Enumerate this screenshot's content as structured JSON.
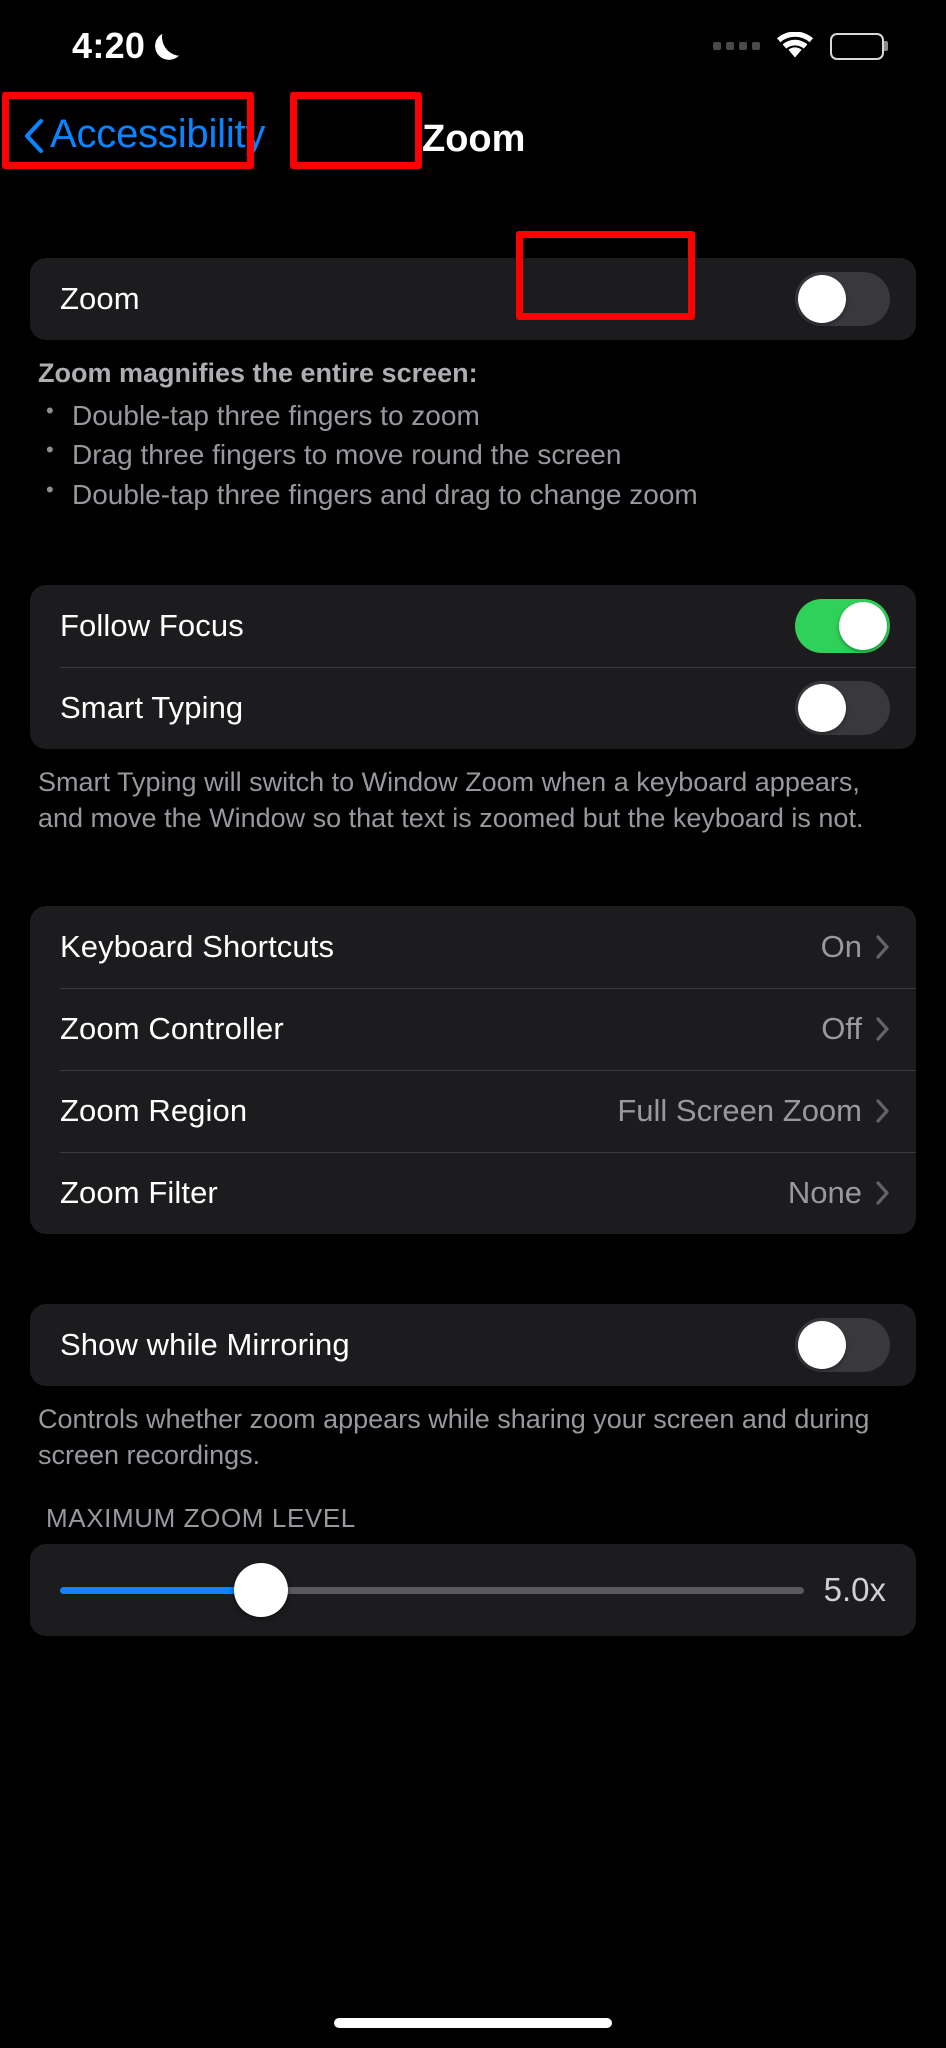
{
  "status_bar": {
    "time": "4:20",
    "dnd_icon": "moon-icon",
    "signal_icon": "signal-dots-icon",
    "wifi_icon": "wifi-icon",
    "battery_icon": "battery-icon"
  },
  "nav": {
    "back_label": "Accessibility",
    "back_icon": "chevron-left-icon",
    "title": "Zoom"
  },
  "zoom_section": {
    "row_label": "Zoom",
    "toggle_state": "off",
    "description_title": "Zoom magnifies the entire screen:",
    "bullets": [
      "Double-tap three fingers to zoom",
      "Drag three fingers to move round the screen",
      "Double-tap three fingers and drag to change zoom"
    ]
  },
  "focus_section": {
    "rows": [
      {
        "label": "Follow Focus",
        "toggle_state": "on"
      },
      {
        "label": "Smart Typing",
        "toggle_state": "off"
      }
    ],
    "footer": "Smart Typing will switch to Window Zoom when a keyboard appears, and move the Window so that text is zoomed but the keyboard is not."
  },
  "options_section": {
    "rows": [
      {
        "label": "Keyboard Shortcuts",
        "value": "On"
      },
      {
        "label": "Zoom Controller",
        "value": "Off"
      },
      {
        "label": "Zoom Region",
        "value": "Full Screen Zoom"
      },
      {
        "label": "Zoom Filter",
        "value": "None"
      }
    ],
    "chevron_icon": "chevron-right-icon"
  },
  "mirroring_section": {
    "row_label": "Show while Mirroring",
    "toggle_state": "off",
    "footer": "Controls whether zoom appears while sharing your screen and during screen recordings."
  },
  "max_zoom_section": {
    "header": "MAXIMUM ZOOM LEVEL",
    "value_label": "5.0x",
    "slider_percent": 27
  },
  "colors": {
    "accent_blue": "#0a84ff",
    "toggle_on_green": "#30d158",
    "annotation_red": "#ff0000",
    "group_bg": "#1c1c1e"
  },
  "annotations": [
    {
      "name": "back-button-highlight"
    },
    {
      "name": "nav-title-highlight"
    },
    {
      "name": "zoom-toggle-highlight"
    }
  ],
  "home_indicator": "home-indicator"
}
